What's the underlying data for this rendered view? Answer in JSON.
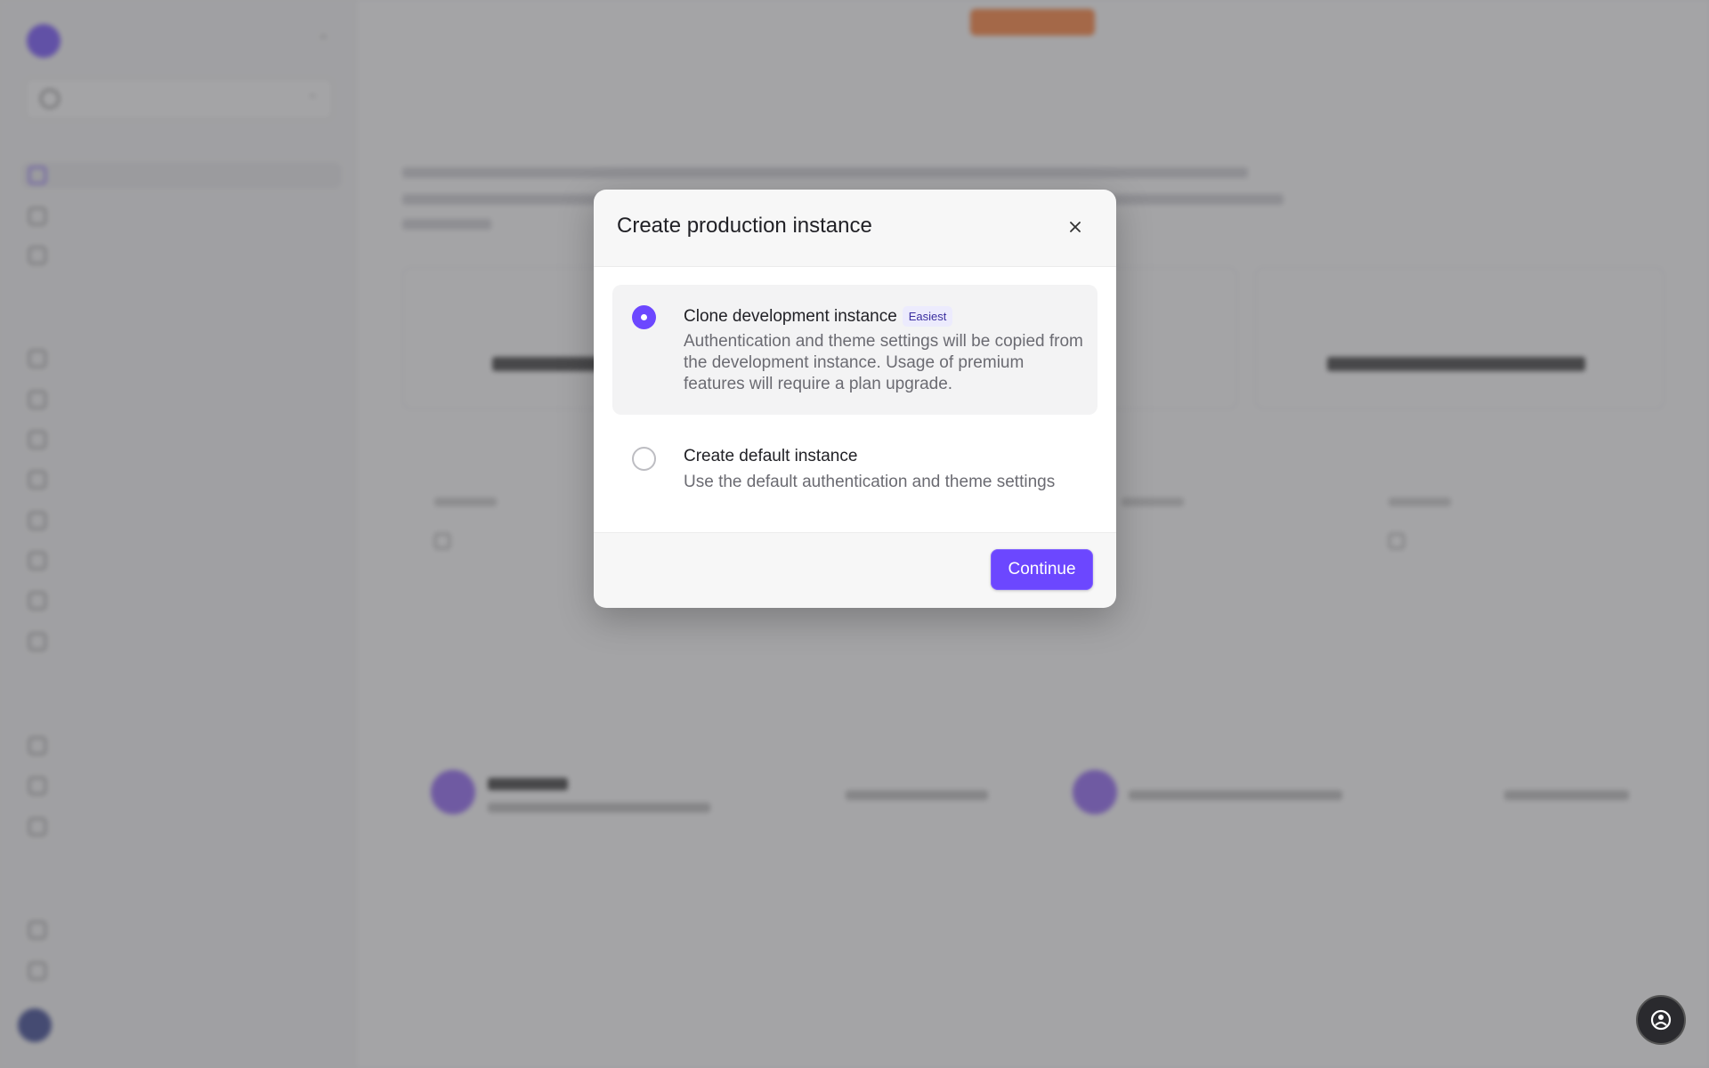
{
  "modal": {
    "title": "Create production instance",
    "close_icon": "close-icon",
    "options": [
      {
        "title": "Clone development instance",
        "badge": "Easiest",
        "description": "Authentication and theme settings will be copied from the development instance. Usage of premium features will require a plan upgrade.",
        "selected": true
      },
      {
        "title": "Create default instance",
        "description": "Use the default authentication and theme settings",
        "selected": false
      }
    ],
    "continue_label": "Continue"
  },
  "help_button": {
    "icon": "help-chat-icon"
  },
  "colors": {
    "accent": "#6c47ff",
    "overlay": "#5a5a5c",
    "toast": "#1a1a1f",
    "badge_orange": "#ff7a2f"
  }
}
